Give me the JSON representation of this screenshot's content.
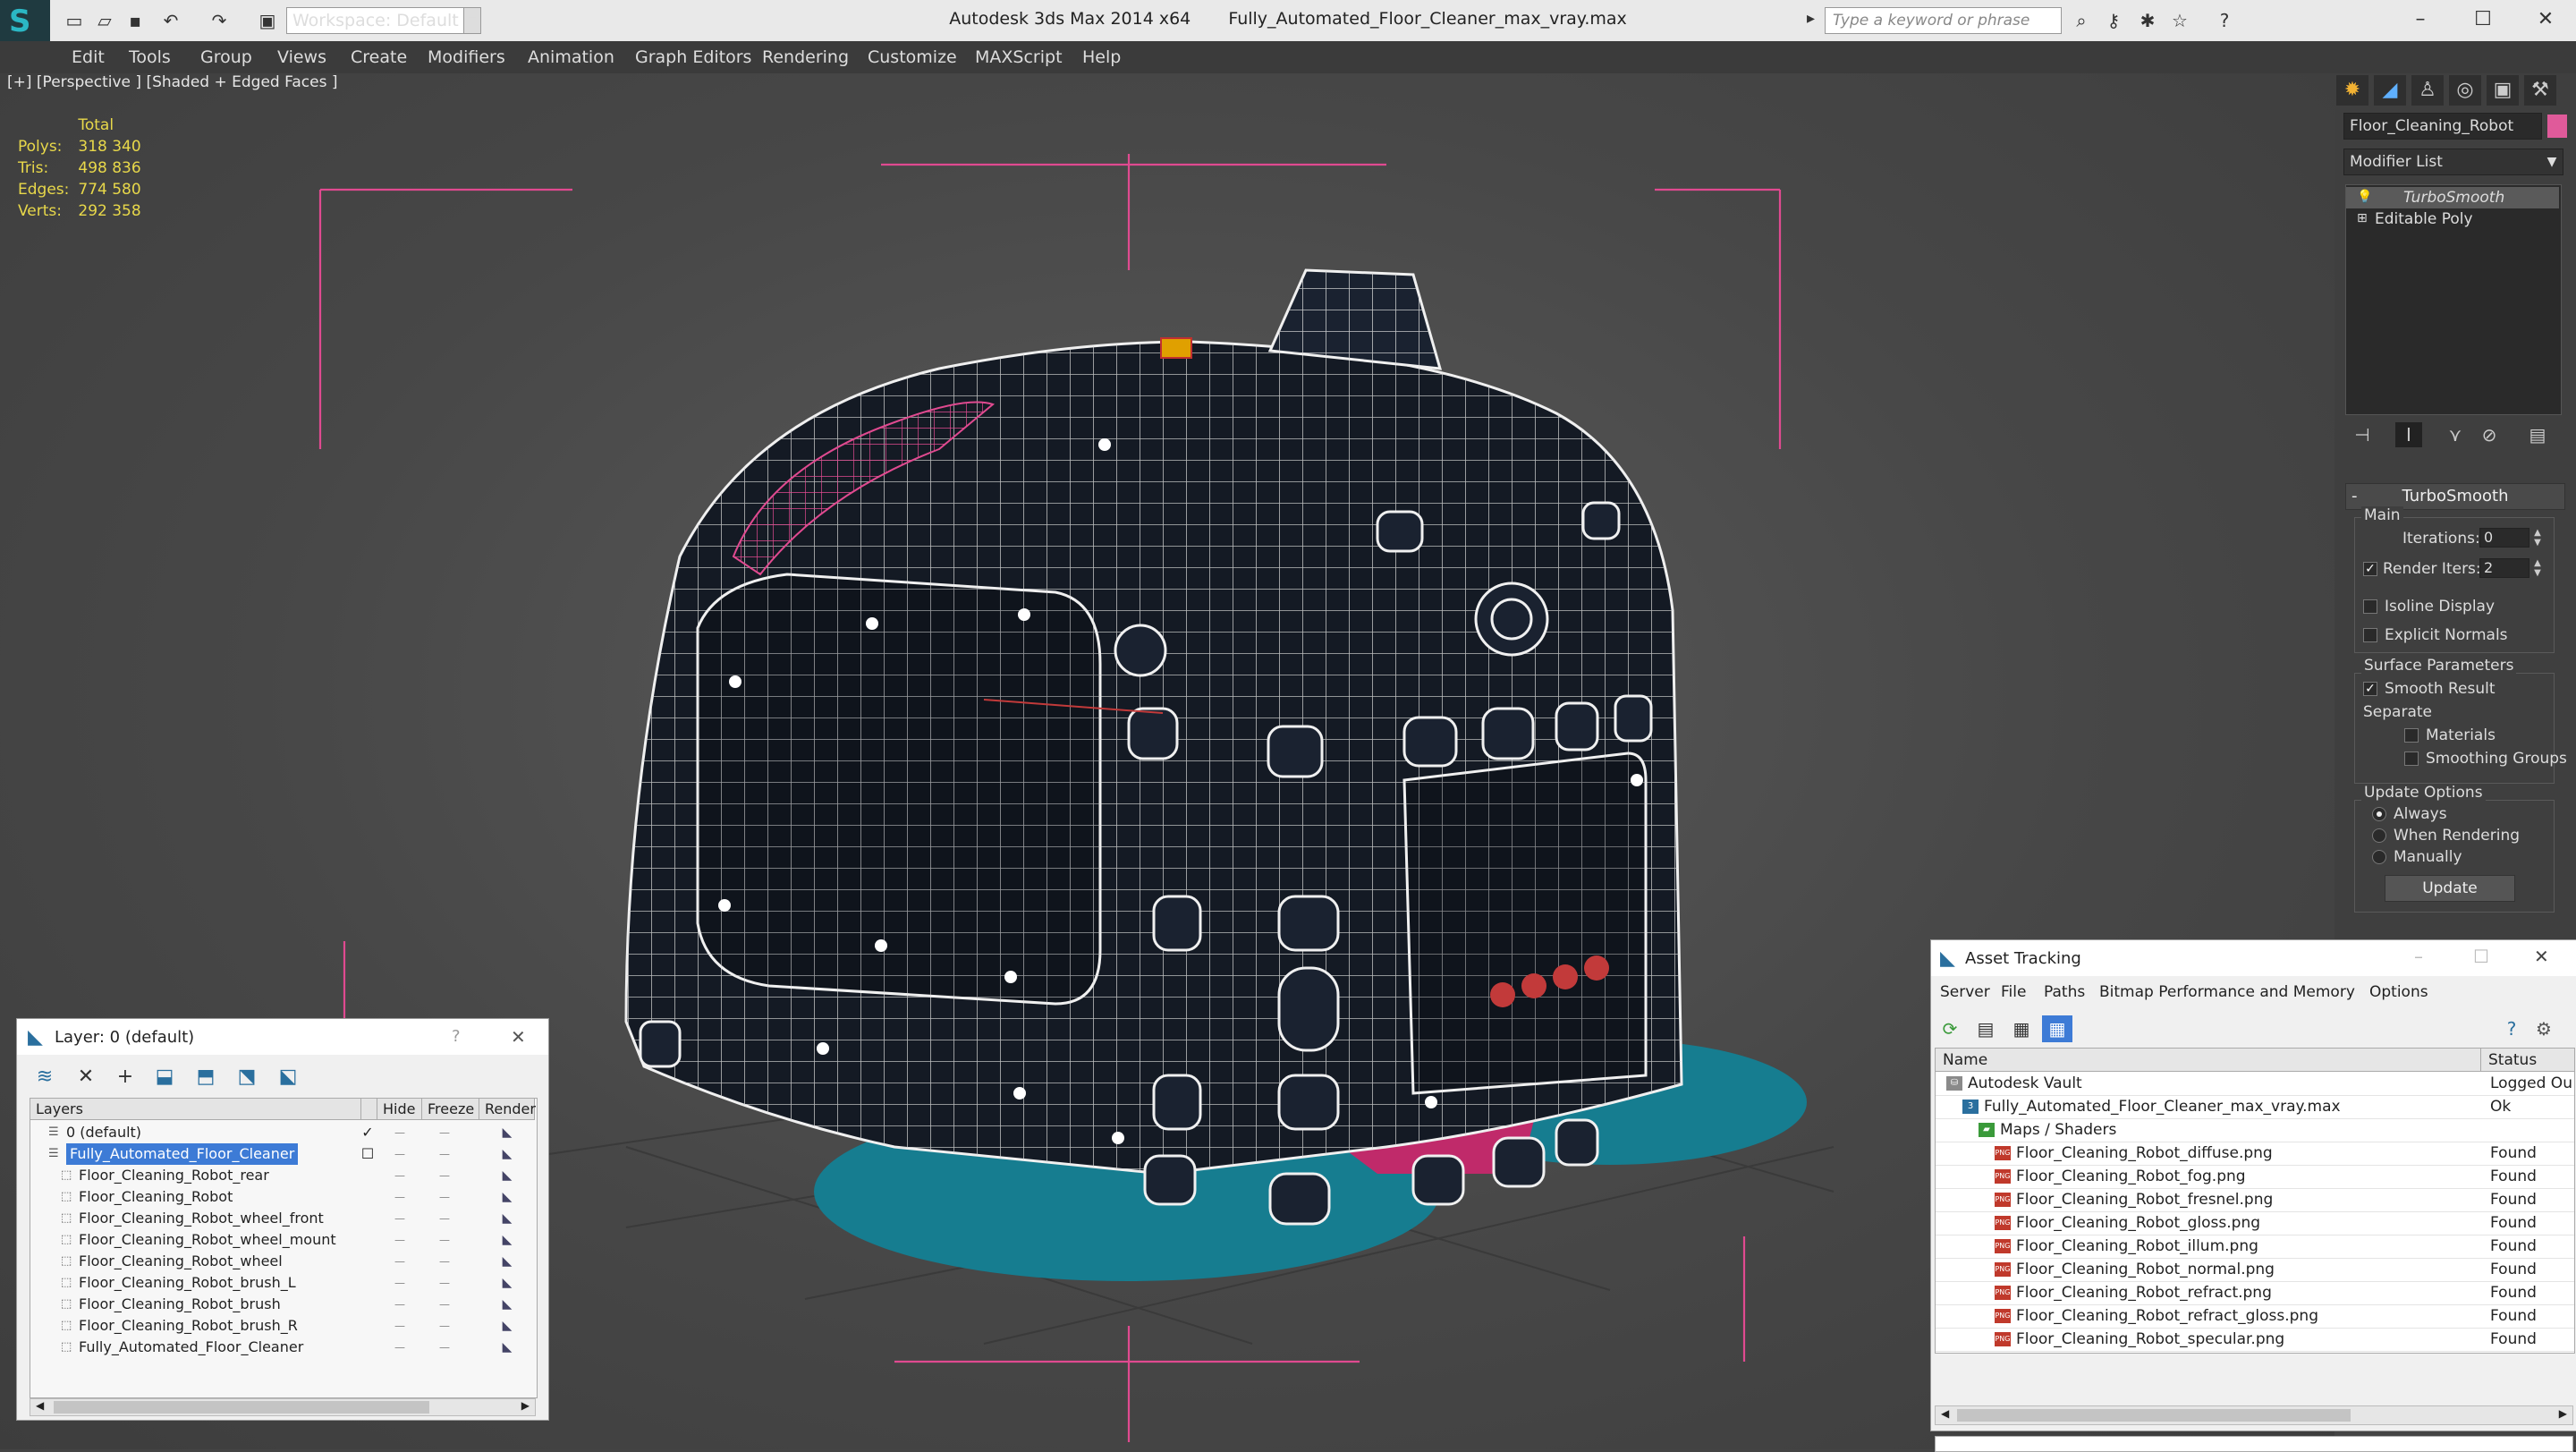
{
  "app": {
    "name": "Autodesk 3ds Max 2014 x64",
    "file": "Fully_Automated_Floor_Cleaner_max_vray.max",
    "workspace": "Workspace: Default",
    "search_placeholder": "Type a keyword or phrase"
  },
  "menu": [
    "Edit",
    "Tools",
    "Group",
    "Views",
    "Create",
    "Modifiers",
    "Animation",
    "Graph Editors",
    "Rendering",
    "Customize",
    "MAXScript",
    "Help"
  ],
  "viewport": {
    "label": "[+] [Perspective ] [Shaded + Edged Faces ]",
    "stats": {
      "header": "Total",
      "rows": [
        {
          "label": "Polys:",
          "value": "318 340"
        },
        {
          "label": "Tris:",
          "value": "498 836"
        },
        {
          "label": "Edges:",
          "value": "774 580"
        },
        {
          "label": "Verts:",
          "value": "292 358"
        }
      ]
    }
  },
  "command_panel": {
    "object_name": "Floor_Cleaning_Robot",
    "object_color": "#e05a9a",
    "modifier_list": "Modifier List",
    "stack": [
      "TurboSmooth",
      "Editable Poly"
    ],
    "turbosmooth": {
      "title": "TurboSmooth",
      "main": "Main",
      "iterations_label": "Iterations:",
      "iterations": "0",
      "render_iters_label": "Render Iters:",
      "render_iters": "2",
      "isoline": "Isoline Display",
      "explicit_normals": "Explicit Normals",
      "surface_params": "Surface Parameters",
      "smooth_result": "Smooth Result",
      "separate": "Separate",
      "materials": "Materials",
      "smoothing_groups": "Smoothing Groups",
      "update_options": "Update Options",
      "always": "Always",
      "when_rendering": "When Rendering",
      "manually": "Manually",
      "update": "Update"
    }
  },
  "layer_window": {
    "title": "Layer: 0 (default)",
    "help": "?",
    "close": "✕",
    "columns": [
      "Layers",
      "Hide",
      "Freeze",
      "Render"
    ],
    "rows": [
      {
        "name": "0 (default)",
        "indent": 0
      },
      {
        "name": "Fully_Automated_Floor_Cleaner",
        "indent": 0
      },
      {
        "name": "Floor_Cleaning_Robot_rear",
        "indent": 1
      },
      {
        "name": "Floor_Cleaning_Robot",
        "indent": 1
      },
      {
        "name": "Floor_Cleaning_Robot_wheel_front",
        "indent": 1
      },
      {
        "name": "Floor_Cleaning_Robot_wheel_mount",
        "indent": 1
      },
      {
        "name": "Floor_Cleaning_Robot_wheel",
        "indent": 1
      },
      {
        "name": "Floor_Cleaning_Robot_brush_L",
        "indent": 1
      },
      {
        "name": "Floor_Cleaning_Robot_brush",
        "indent": 1
      },
      {
        "name": "Floor_Cleaning_Robot_brush_R",
        "indent": 1
      },
      {
        "name": "Fully_Automated_Floor_Cleaner",
        "indent": 1
      }
    ]
  },
  "asset_window": {
    "title": "Asset Tracking",
    "menu": [
      "Server",
      "File",
      "Paths",
      "Bitmap Performance and Memory",
      "Options"
    ],
    "columns": [
      "Name",
      "Status"
    ],
    "rows": [
      {
        "name": "Autodesk Vault",
        "status": "Logged Ou",
        "level": 0,
        "type": "vault"
      },
      {
        "name": "Fully_Automated_Floor_Cleaner_max_vray.max",
        "status": "Ok",
        "level": 1,
        "type": "max"
      },
      {
        "name": "Maps / Shaders",
        "status": "",
        "level": 2,
        "type": "folder"
      },
      {
        "name": "Floor_Cleaning_Robot_diffuse.png",
        "status": "Found",
        "level": 3,
        "type": "png"
      },
      {
        "name": "Floor_Cleaning_Robot_fog.png",
        "status": "Found",
        "level": 3,
        "type": "png"
      },
      {
        "name": "Floor_Cleaning_Robot_fresnel.png",
        "status": "Found",
        "level": 3,
        "type": "png"
      },
      {
        "name": "Floor_Cleaning_Robot_gloss.png",
        "status": "Found",
        "level": 3,
        "type": "png"
      },
      {
        "name": "Floor_Cleaning_Robot_illum.png",
        "status": "Found",
        "level": 3,
        "type": "png"
      },
      {
        "name": "Floor_Cleaning_Robot_normal.png",
        "status": "Found",
        "level": 3,
        "type": "png"
      },
      {
        "name": "Floor_Cleaning_Robot_refract.png",
        "status": "Found",
        "level": 3,
        "type": "png"
      },
      {
        "name": "Floor_Cleaning_Robot_refract_gloss.png",
        "status": "Found",
        "level": 3,
        "type": "png"
      },
      {
        "name": "Floor_Cleaning_Robot_specular.png",
        "status": "Found",
        "level": 3,
        "type": "png"
      }
    ]
  },
  "icons": {
    "png_badge": "PNG",
    "max_badge": "3"
  }
}
